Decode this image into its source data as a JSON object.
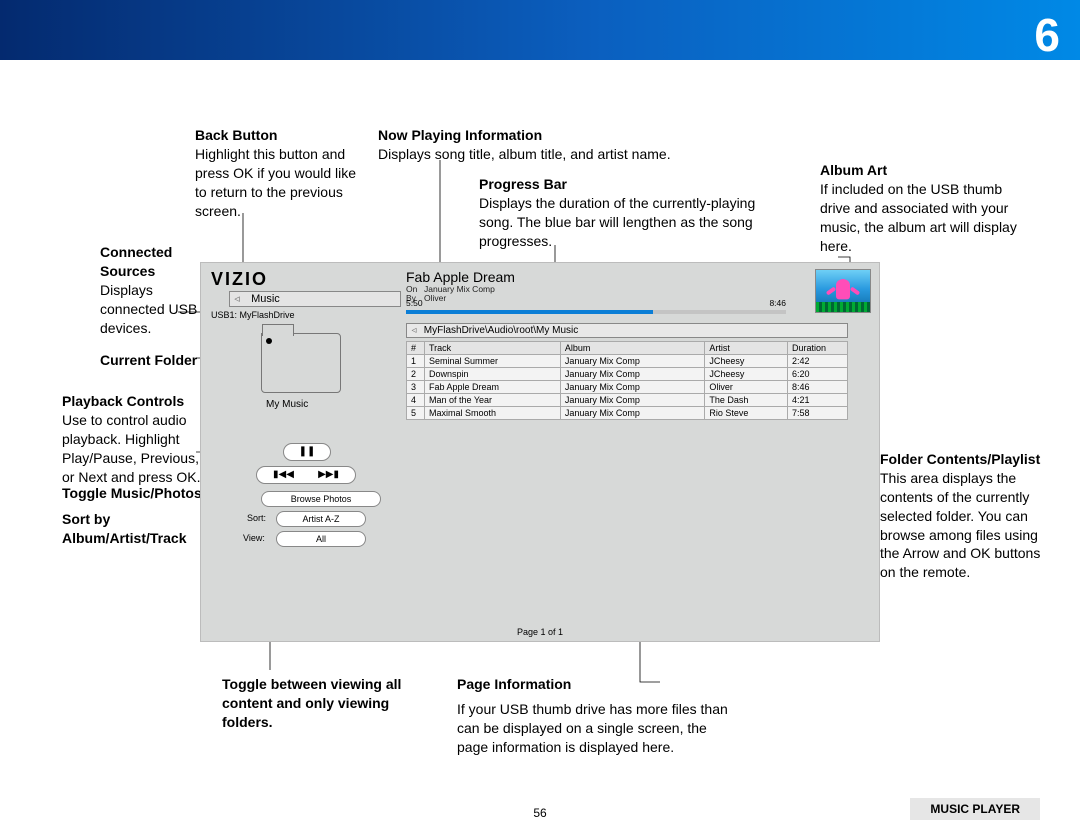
{
  "page": {
    "chapter_big": "6",
    "footer_num": "56",
    "footer_badge": "MUSIC PLAYER"
  },
  "callouts": {
    "back_btn": {
      "h": "Back Button",
      "t": "Highlight this button and press OK if you would like to return to the previous screen."
    },
    "connected": {
      "h": "Connected Sources",
      "t": "Displays connected USB devices."
    },
    "cur_folder": {
      "h": "Current Folder"
    },
    "playback": {
      "h": "Playback Controls",
      "t": "Use to control audio playback. Highlight Play/Pause, Previous, or Next and press OK."
    },
    "toggle_mp": {
      "h": "Toggle Music/Photos"
    },
    "sort": {
      "h": "Sort by Album/Artist/Track"
    },
    "toggle_view": {
      "h": "Toggle between viewing all content and only viewing folders."
    },
    "now_play": {
      "h": "Now Playing Information",
      "t": "Displays song title, album title, and artist name."
    },
    "progress": {
      "h": "Progress Bar",
      "t": "Displays the duration of the currently-playing song. The blue bar will lengthen as the song progresses."
    },
    "album_art": {
      "h": "Album Art",
      "t": "If included on the USB thumb drive and associated with your music, the album art will display here."
    },
    "folder_cont": {
      "h": "Folder Contents/Playlist",
      "t": "This area displays the contents of the currently selected folder. You can browse among files using the Arrow and OK buttons on the remote."
    },
    "page_info": {
      "h": "Page Information",
      "t": "If your USB thumb drive has more files than can be displayed on a single screen, the page information is displayed here."
    }
  },
  "player": {
    "brand": "VIZIO",
    "back_label": "Music",
    "usb_line": "USB1: MyFlashDrive",
    "folder_name": "My Music",
    "browse_label": "Browse Photos",
    "sort_label": "Sort:",
    "sort_value": "Artist A-Z",
    "view_label": "View:",
    "view_value": "All",
    "now_title": "Fab Apple Dream",
    "now_on_k": "On",
    "now_on_v": "January Mix Comp",
    "now_by_k": "By",
    "now_by_v": "Oliver",
    "elapsed": "5:50",
    "total": "8:46",
    "breadcrumb": "MyFlashDrive\\Audio\\root\\My Music",
    "page_info": "Page 1 of 1",
    "cols": {
      "n": "#",
      "track": "Track",
      "album": "Album",
      "artist": "Artist",
      "dur": "Duration"
    },
    "rows": [
      {
        "n": "1",
        "track": "Seminal Summer",
        "album": "January Mix Comp",
        "artist": "JCheesy",
        "dur": "2:42"
      },
      {
        "n": "2",
        "track": "Downspin",
        "album": "January Mix Comp",
        "artist": "JCheesy",
        "dur": "6:20"
      },
      {
        "n": "3",
        "track": "Fab Apple Dream",
        "album": "January Mix Comp",
        "artist": "Oliver",
        "dur": "8:46"
      },
      {
        "n": "4",
        "track": "Man of the Year",
        "album": "January Mix Comp",
        "artist": "The Dash",
        "dur": "4:21"
      },
      {
        "n": "5",
        "track": "Maximal Smooth",
        "album": "January Mix Comp",
        "artist": "Rio Steve",
        "dur": "7:58"
      }
    ]
  }
}
